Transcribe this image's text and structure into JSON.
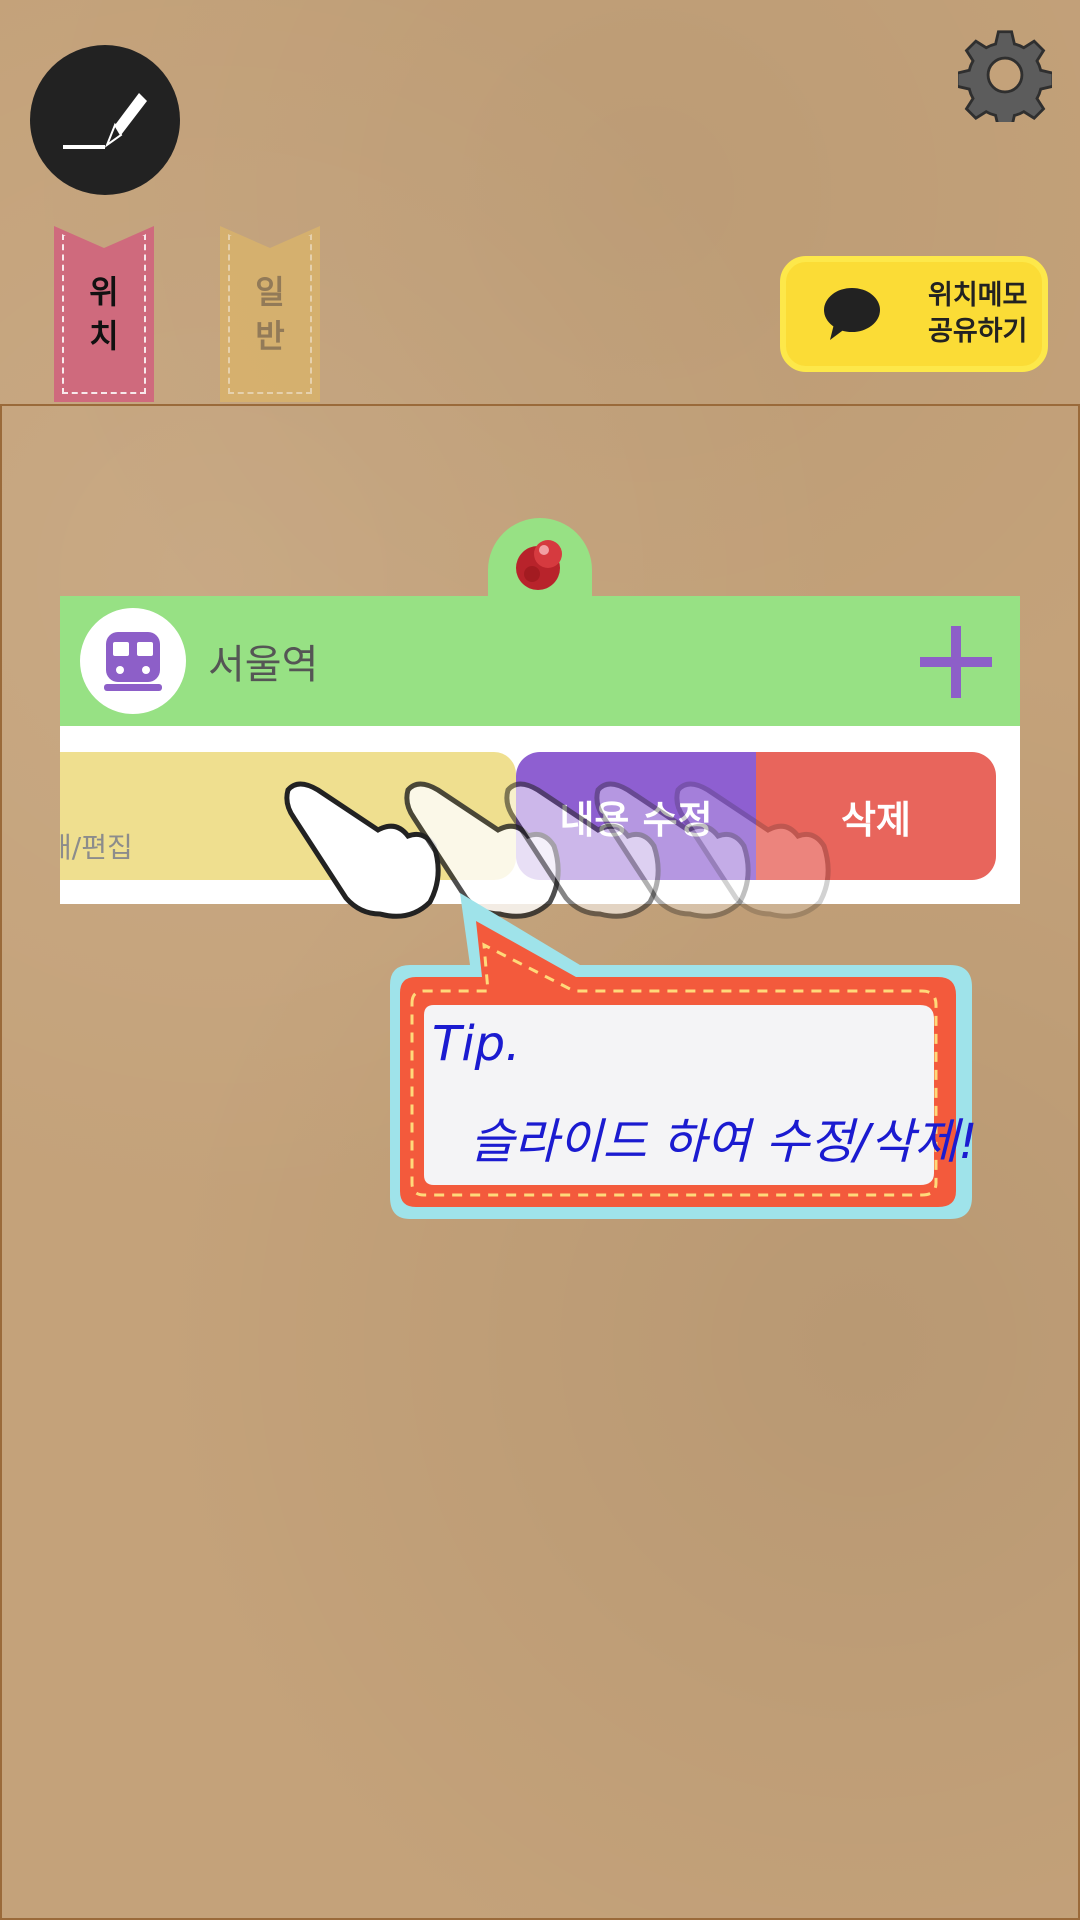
{
  "toolbar": {
    "compose_icon": "pen-icon",
    "settings_icon": "gear-icon"
  },
  "tabs": [
    {
      "label": "위\n치",
      "active": true,
      "color": "#cf6a7d"
    },
    {
      "label": "일\n반",
      "active": false,
      "color": "#d9b36c"
    }
  ],
  "share": {
    "label": "위치메모\n공유하기",
    "icon": "chat-bubble-icon",
    "color": "#fbdc36"
  },
  "card": {
    "title": "서울역",
    "icon": "subway-icon",
    "header_color": "#97e184",
    "memo_hint": "내/편집",
    "edit_label": "내용 수정",
    "delete_label": "삭제"
  },
  "tip": {
    "line1": "Tip.",
    "line2": "슬라이드 하여 수정/삭제!"
  },
  "colors": {
    "background": "#c4a27a",
    "accent_purple": "#8e5fd1",
    "delete_red": "#e8655c",
    "tip_text": "#1b1bd0"
  }
}
